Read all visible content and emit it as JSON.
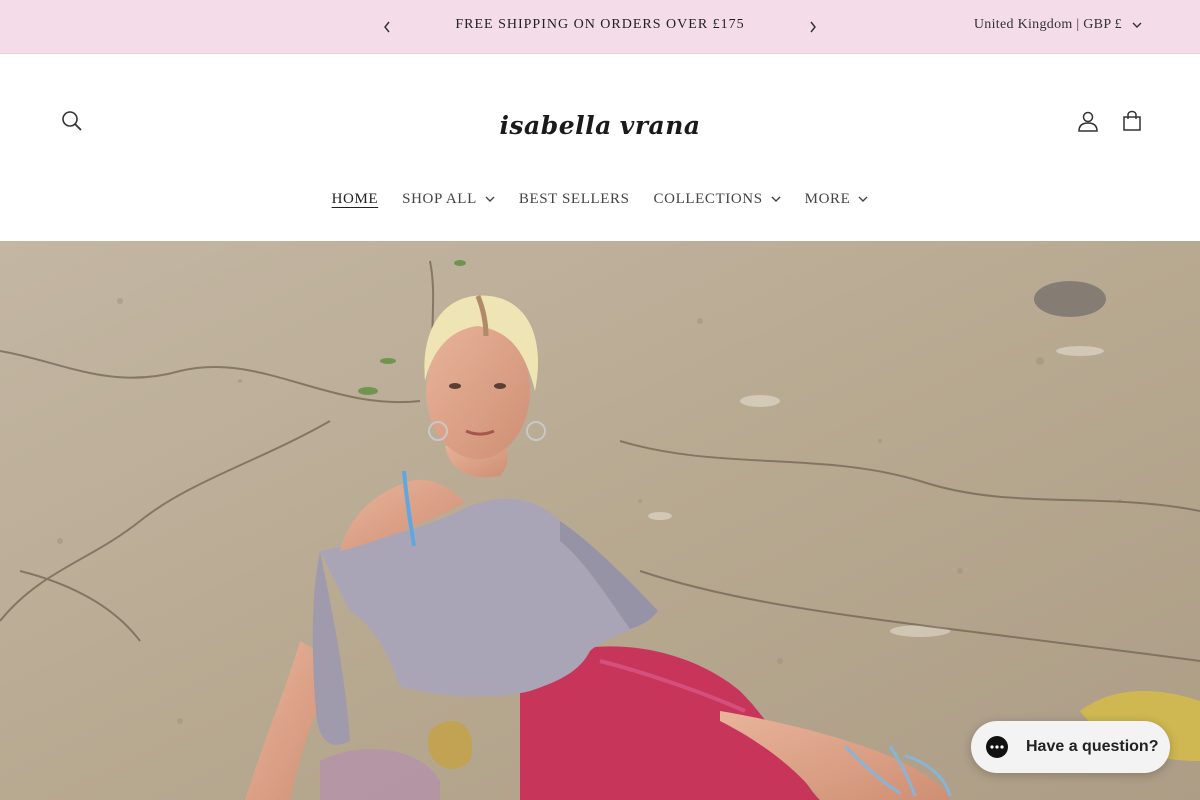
{
  "announcement": {
    "message": "FREE SHIPPING ON ORDERS OVER £175",
    "prev_icon": "chevron-left-icon",
    "next_icon": "chevron-right-icon",
    "locale": "United Kingdom | GBP £"
  },
  "header": {
    "logo_left": "isabella",
    "logo_right": "vrana",
    "icons": [
      "search-icon",
      "account-icon",
      "cart-icon"
    ]
  },
  "nav": {
    "items": [
      {
        "label": "HOME",
        "active": true,
        "has_dropdown": false
      },
      {
        "label": "SHOP ALL",
        "active": false,
        "has_dropdown": true
      },
      {
        "label": "BEST SELLERS",
        "active": false,
        "has_dropdown": false
      },
      {
        "label": "COLLECTIONS",
        "active": false,
        "has_dropdown": true
      },
      {
        "label": "MORE",
        "active": false,
        "has_dropdown": true
      }
    ]
  },
  "chat": {
    "label": "Have a question?",
    "icon": "chat-bubble-icon"
  },
  "colors": {
    "announcement_bg": "#f4dde9",
    "chat_bg": "#f3f3f3"
  }
}
